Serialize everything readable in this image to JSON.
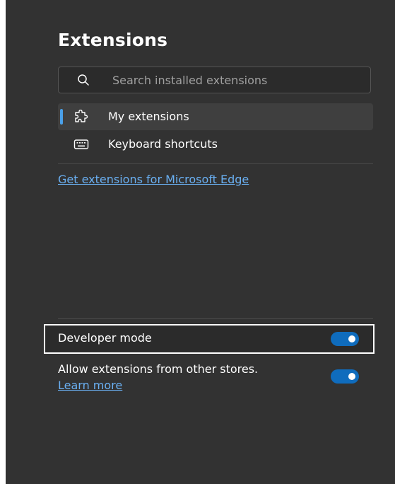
{
  "header": {
    "title": "Extensions"
  },
  "search": {
    "placeholder": "Search installed extensions",
    "value": ""
  },
  "nav": {
    "items": [
      {
        "label": "My extensions",
        "icon": "puzzle-icon",
        "active": true
      },
      {
        "label": "Keyboard shortcuts",
        "icon": "keyboard-icon",
        "active": false
      }
    ]
  },
  "links": {
    "get_extensions": "Get extensions for Microsoft Edge"
  },
  "settings": {
    "developer_mode": {
      "label": "Developer mode",
      "enabled": true
    },
    "other_stores": {
      "label": "Allow extensions from other stores.",
      "link": "Learn more",
      "enabled": true
    }
  },
  "colors": {
    "panel_bg": "#323232",
    "accent": "#0f6cbd",
    "link": "#6ab0f3",
    "indicator": "#4aa0e8"
  }
}
